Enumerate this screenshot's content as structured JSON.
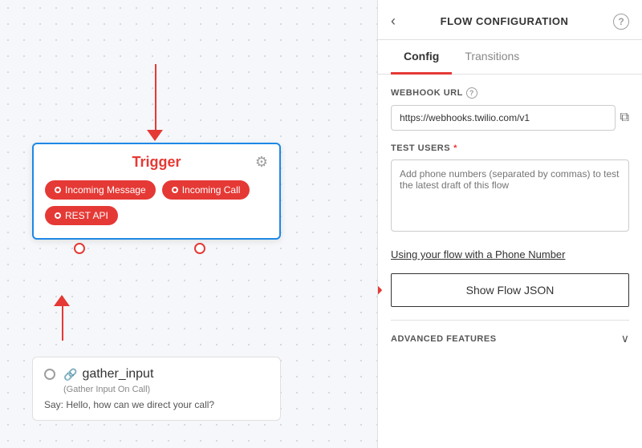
{
  "canvas": {
    "trigger_title": "Trigger",
    "btn_incoming_message": "Incoming Message",
    "btn_incoming_call": "Incoming Call",
    "btn_rest_api": "REST API",
    "gather_title": "gather_input",
    "gather_subtitle": "(Gather Input On Call)",
    "gather_description": "Say: Hello, how can we direct your call?"
  },
  "panel": {
    "back_label": "‹",
    "title": "FLOW CONFIGURATION",
    "help_label": "?",
    "tabs": [
      {
        "label": "Config",
        "active": true
      },
      {
        "label": "Transitions",
        "active": false
      }
    ],
    "webhook_url_label": "WEBHOOK URL",
    "webhook_url_value": "https://webhooks.twilio.com/v1",
    "copy_icon": "⧉",
    "test_users_label": "TEST USERS",
    "test_users_required": "*",
    "test_users_placeholder": "Add phone numbers (separated by commas) to test the latest draft of this flow",
    "phone_number_link": "Using your flow with a Phone Number",
    "show_json_btn": "Show Flow JSON",
    "advanced_label": "ADVANCED FEATURES",
    "chevron": "∨"
  }
}
